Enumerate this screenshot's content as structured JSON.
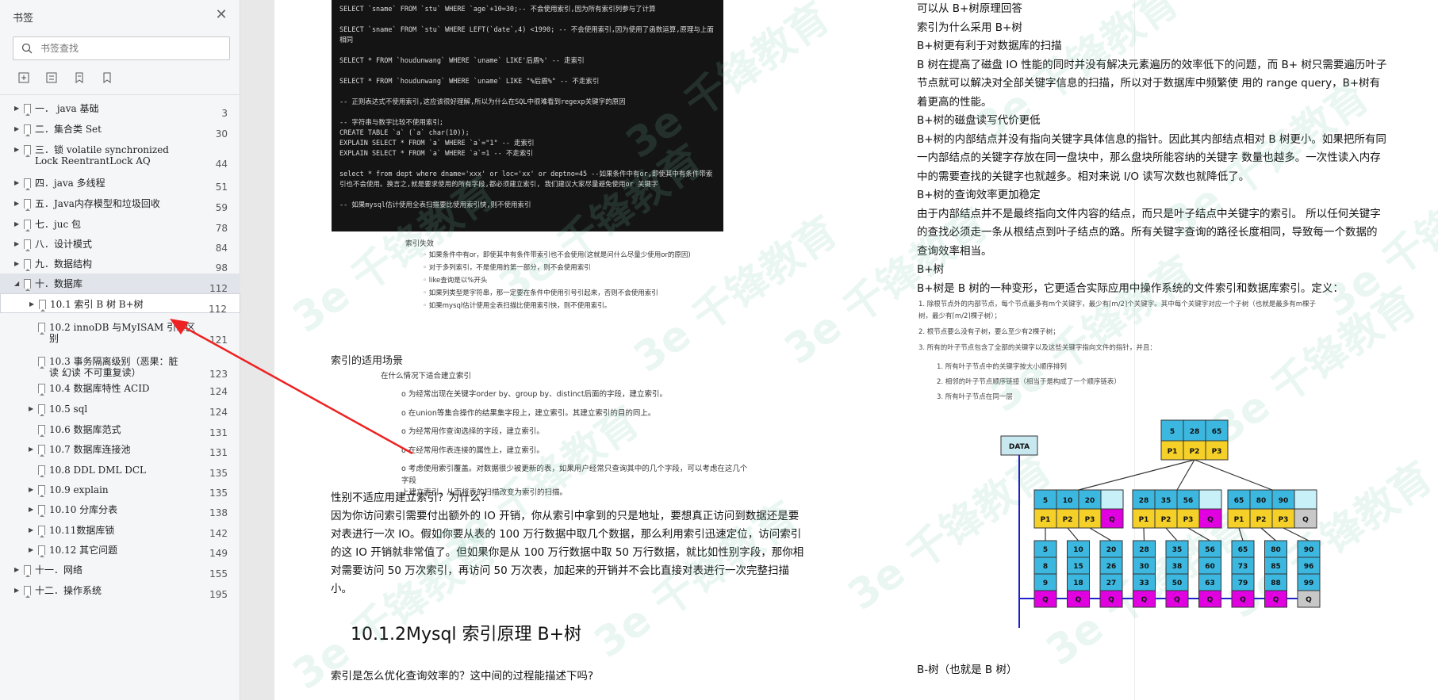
{
  "sidebar": {
    "title": "书签",
    "search_placeholder": "书签查找",
    "items": [
      {
        "label": "一．  java 基础",
        "page": "3"
      },
      {
        "label": "二．集合类 Set",
        "page": "30"
      },
      {
        "label": "三．锁 volatile  synchronized\nLock  ReentrantLock AQ",
        "page": "44"
      },
      {
        "label": "四．java 多线程",
        "page": "51"
      },
      {
        "label": "五．Java内存模型和垃圾回收",
        "page": "59"
      },
      {
        "label": "七．juc 包",
        "page": "78"
      },
      {
        "label": "八．设计模式",
        "page": "84"
      },
      {
        "label": "九．数据结构",
        "page": "98"
      },
      {
        "label": "十．数据库",
        "page": "112"
      },
      {
        "label": "10.1 索引 B 树 B+树",
        "page": "112"
      },
      {
        "label": "10.2 innoDB 与MyISAM 引擎区\n别",
        "page": "121"
      },
      {
        "label": "10.3 事务隔离级别（恶果：脏\n读 幻读 不可重复读）",
        "page": "123"
      },
      {
        "label": "10.4 数据库特性 ACID",
        "page": "124"
      },
      {
        "label": "10.5 sql",
        "page": "124"
      },
      {
        "label": "10.6 数据库范式",
        "page": "131"
      },
      {
        "label": "10.7 数据库连接池",
        "page": "131"
      },
      {
        "label": "10.8 DDL DML DCL",
        "page": "135"
      },
      {
        "label": "10.9 explain",
        "page": "135"
      },
      {
        "label": "10.10 分库分表",
        "page": "138"
      },
      {
        "label": "10.11数据库锁",
        "page": "142"
      },
      {
        "label": "10.12 其它问题",
        "page": "149"
      },
      {
        "label": "十一．网络",
        "page": "155"
      },
      {
        "label": "十二．操作系统",
        "page": "195"
      }
    ]
  },
  "code_lines": [
    "SELECT `sname` FROM `stu` WHERE `age`+10=30;-- 不会使用索引,因为所有索引列参与了计算",
    "SELECT `sname` FROM `stu` WHERE LEFT(`date`,4) <1990; -- 不会使用索引,因为使用了函数运算,原理与上面相同",
    "SELECT * FROM `houdunwang` WHERE `uname` LIKE'后盾%' -- 走索引",
    "SELECT * FROM `houdunwang` WHERE `uname` LIKE \"%后盾%\" -- 不走索引",
    "-- 正则表达式不使用索引,这应该很好理解,所以为什么在SQL中很难看到regexp关键字的原因",
    "-- 字符串与数字比较不使用索引;\nCREATE TABLE `a` (`a` char(10));\nEXPLAIN SELECT * FROM `a` WHERE `a`=\"1\" -- 走索引\nEXPLAIN SELECT * FROM `a` WHERE `a`=1 -- 不走索引",
    "select * from dept where dname='xxx' or loc='xx' or deptno=45 --如果条件中有or,即使其中有条件带索引也不会使用。换言之,就是要求使用的所有字段,都必须建立索引, 我们建议大家尽量避免使用or 关键字",
    "-- 如果mysql估计使用全表扫描要比使用索引快,则不使用索引"
  ],
  "bullets": {
    "head": "索引失效",
    "items": [
      "如果条件中有or，即使其中有条件带索引也不会使用(这就是问什么尽量少使用or的原因)",
      "对于多列索引，不是使用的第一部分，则不会使用索引",
      "like查询是以%开头",
      "如果列类型是字符串，那一定要在条件中使用引号引起来，否则不会使用索引",
      "如果mysql估计使用全表扫描比使用索引快，则不使用索引。"
    ]
  },
  "left_doc": {
    "section": "索引的适用场景",
    "sub_head": "在什么情况下适合建立索引",
    "sub_items": [
      "为经常出现在关键字order by、group by、distinct后面的字段，建立索引。",
      "在union等集合操作的结果集字段上，建立索引。其建立索引的目的同上。",
      "为经常用作查询选择的字段，建立索引。",
      "在经常用作表连接的属性上，建立索引。",
      "考虑使用索引覆盖。对数据很少被更新的表，如果用户经常只查询其中的几个字段，可以考虑在这几个字段\n上建立索引，从而将表的扫描改变为索引的扫描。"
    ],
    "q_title": "性别不适应用建立索引？为什么？",
    "q_body": [
      "因为你访问索引需要付出额外的 IO 开销，你从索引中拿到的只是地址，要想真正访问到数据还是要",
      "对表进行一次 IO。假如你要从表的 100 万行数据中取几个数据，那么利用索引迅速定位，访问索引",
      "的这 IO 开销就非常值了。但如果你是从 100 万行数据中取 50 万行数据，就比如性别字段，那你相",
      "对需要访问 50 万次索引，再访问 50 万次表，加起来的开销并不会比直接对表进行一次完整扫描",
      "小。"
    ],
    "heading": "10.1.2Mysql 索引原理 B+树",
    "last_line": "索引是怎么优化查询效率的？这中间的过程能描述下吗?"
  },
  "right_doc": {
    "lines": [
      "可以从 B+树原理回答",
      "索引为什么采用 B+树",
      "B+树更有利于对数据库的扫描",
      "B 树在提高了磁盘 IO 性能的同时并没有解决元素遍历的效率低下的问题，而 B+ 树只需要遍历叶子",
      "节点就可以解决对全部关键字信息的扫描，所以对于数据库中频繁使  用的 range query，B+树有",
      "着更高的性能。",
      "B+树的磁盘读写代价更低",
      "B+树的内部结点并没有指向关键字具体信息的指针。因此其内部结点相对 B 树更小。如果把所有同",
      "一内部结点的关键字存放在同一盘块中，那么盘块所能容纳的关键字  数量也越多。一次性读入内存",
      "中的需要查找的关键字也就越多。相对来说 I/O 读写次数也就降低了。",
      "B+树的查询效率更加稳定",
      "由于内部结点并不是最终指向文件内容的结点，而只是叶子结点中关键字的索引。  所以任何关键字",
      "的查找必须走一条从根结点到叶子结点的路。所有关键字查询的路径长度相同，导致每一个数据的",
      "查询效率相当。",
      "B+树",
      "B+树是 B 树的一种变形，它更适合实际应用中操作系统的文件索引和数据库索引。定义："
    ],
    "defs": [
      "1. 除根节点外的内部节点，每个节点最多有m个关键字，最少有⌈m/2⌉个关键字。其中每个关键字对应一个子树（也就是最多有m棵子",
      "    树，最少有⌈m/2⌉棵子树）；",
      "2. 根节点要么没有子树，要么至少有2棵子树；",
      "3. 所有的叶子节点包含了全部的关键字以及这些关键字指向文件的指针，并且："
    ],
    "subdefs": [
      "1. 所有叶子节点中的关键字按大小顺序排列",
      "2. 相邻的叶子节点顺序链接（相当于是构成了一个顺序链表）",
      "3. 所有叶子节点在同一层"
    ],
    "footer": "B-树（也就是 B 树）"
  },
  "diagram": {
    "data_label": "DATA",
    "root_keys": [
      "5",
      "28",
      "65"
    ],
    "root_ptrs": [
      "P1",
      "P2",
      "P3"
    ],
    "internal": [
      {
        "keys": [
          "5",
          "10",
          "20"
        ],
        "ptrs": [
          "P1",
          "P2",
          "P3"
        ],
        "q": "Q"
      },
      {
        "keys": [
          "28",
          "35",
          "56"
        ],
        "ptrs": [
          "P1",
          "P2",
          "P3"
        ],
        "q": "Q"
      },
      {
        "keys": [
          "65",
          "80",
          "90"
        ],
        "ptrs": [
          "P1",
          "P2",
          "P3"
        ],
        "q": "Q"
      }
    ],
    "leaves": [
      [
        "5",
        "8",
        "9"
      ],
      [
        "10",
        "15",
        "18"
      ],
      [
        "20",
        "26",
        "27"
      ],
      [
        "28",
        "30",
        "33"
      ],
      [
        "35",
        "38",
        "50"
      ],
      [
        "56",
        "60",
        "63"
      ],
      [
        "65",
        "73",
        "79"
      ],
      [
        "80",
        "85",
        "88"
      ],
      [
        "90",
        "96",
        "99"
      ]
    ],
    "leaf_q": "Q",
    "colors": {
      "key": "#3cb8e0",
      "ptr": "#f4d028",
      "q": "#e000e0",
      "q_last": "#c8c8c8",
      "arrow": "#2020c8"
    }
  },
  "watermark": "3e 千锋教育"
}
